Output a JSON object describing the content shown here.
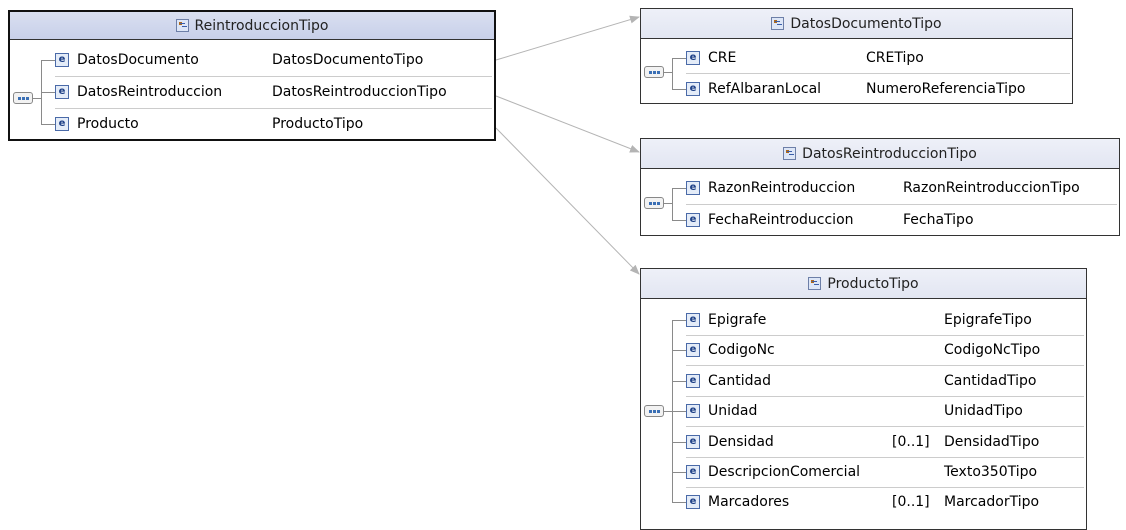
{
  "boxes": {
    "reintroduccion": {
      "title": "ReintroduccionTipo",
      "rows": [
        {
          "name": "DatosDocumento",
          "type": "DatosDocumentoTipo"
        },
        {
          "name": "DatosReintroduccion",
          "type": "DatosReintroduccionTipo"
        },
        {
          "name": "Producto",
          "type": "ProductoTipo"
        }
      ]
    },
    "datos_documento": {
      "title": "DatosDocumentoTipo",
      "rows": [
        {
          "name": "CRE",
          "type": "CRETipo"
        },
        {
          "name": "RefAlbaranLocal",
          "type": "NumeroReferenciaTipo"
        }
      ]
    },
    "datos_reintroduccion": {
      "title": "DatosReintroduccionTipo",
      "rows": [
        {
          "name": "RazonReintroduccion",
          "type": "RazonReintroduccionTipo"
        },
        {
          "name": "FechaReintroduccion",
          "type": "FechaTipo"
        }
      ]
    },
    "producto": {
      "title": "ProductoTipo",
      "rows": [
        {
          "name": "Epigrafe",
          "type": "EpigrafeTipo"
        },
        {
          "name": "CodigoNc",
          "type": "CodigoNcTipo"
        },
        {
          "name": "Cantidad",
          "type": "CantidadTipo"
        },
        {
          "name": "Unidad",
          "type": "UnidadTipo"
        },
        {
          "name": "Densidad",
          "type": "DensidadTipo",
          "cardinality": "[0..1]"
        },
        {
          "name": "DescripcionComercial",
          "type": "Texto350Tipo"
        },
        {
          "name": "Marcadores",
          "type": "MarcadorTipo",
          "cardinality": "[0..1]"
        }
      ]
    }
  },
  "element_icon_letter": "e",
  "icons": {
    "complex_type": "complex-type-icon",
    "element": "element-icon",
    "sequence": "sequence-icon"
  },
  "colors": {
    "connector": "#b4b4b4",
    "header_bg": "#e2e6f2",
    "icon_border": "#4a6aa8"
  }
}
